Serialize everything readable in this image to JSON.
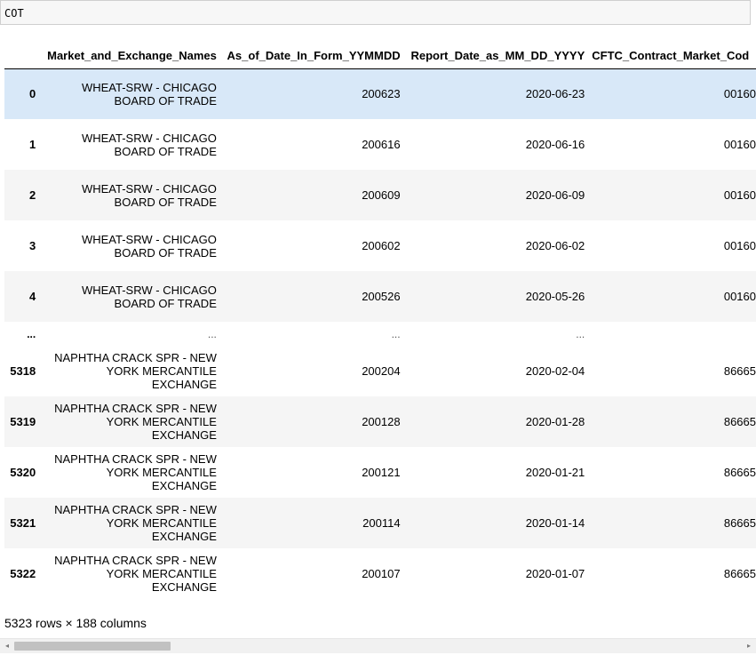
{
  "cell_input": "COT",
  "table": {
    "columns": [
      "Market_and_Exchange_Names",
      "As_of_Date_In_Form_YYMMDD",
      "Report_Date_as_MM_DD_YYYY",
      "CFTC_Contract_Market_Cod"
    ],
    "rows": [
      {
        "index": "0",
        "name_lines": [
          "WHEAT-SRW - CHICAGO",
          "BOARD OF TRADE"
        ],
        "yymmdd": "200623",
        "date": "2020-06-23",
        "code": "00160"
      },
      {
        "index": "1",
        "name_lines": [
          "WHEAT-SRW - CHICAGO",
          "BOARD OF TRADE"
        ],
        "yymmdd": "200616",
        "date": "2020-06-16",
        "code": "00160"
      },
      {
        "index": "2",
        "name_lines": [
          "WHEAT-SRW - CHICAGO",
          "BOARD OF TRADE"
        ],
        "yymmdd": "200609",
        "date": "2020-06-09",
        "code": "00160"
      },
      {
        "index": "3",
        "name_lines": [
          "WHEAT-SRW - CHICAGO",
          "BOARD OF TRADE"
        ],
        "yymmdd": "200602",
        "date": "2020-06-02",
        "code": "00160"
      },
      {
        "index": "4",
        "name_lines": [
          "WHEAT-SRW - CHICAGO",
          "BOARD OF TRADE"
        ],
        "yymmdd": "200526",
        "date": "2020-05-26",
        "code": "00160"
      }
    ],
    "ellipsis_row": {
      "index": "...",
      "cell": "..."
    },
    "rows_tail": [
      {
        "index": "5318",
        "name_lines": [
          "NAPHTHA CRACK SPR - NEW",
          "YORK MERCANTILE",
          "EXCHANGE"
        ],
        "yymmdd": "200204",
        "date": "2020-02-04",
        "code": "86665"
      },
      {
        "index": "5319",
        "name_lines": [
          "NAPHTHA CRACK SPR - NEW",
          "YORK MERCANTILE",
          "EXCHANGE"
        ],
        "yymmdd": "200128",
        "date": "2020-01-28",
        "code": "86665"
      },
      {
        "index": "5320",
        "name_lines": [
          "NAPHTHA CRACK SPR - NEW",
          "YORK MERCANTILE",
          "EXCHANGE"
        ],
        "yymmdd": "200121",
        "date": "2020-01-21",
        "code": "86665"
      },
      {
        "index": "5321",
        "name_lines": [
          "NAPHTHA CRACK SPR - NEW",
          "YORK MERCANTILE",
          "EXCHANGE"
        ],
        "yymmdd": "200114",
        "date": "2020-01-14",
        "code": "86665"
      },
      {
        "index": "5322",
        "name_lines": [
          "NAPHTHA CRACK SPR - NEW",
          "YORK MERCANTILE",
          "EXCHANGE"
        ],
        "yymmdd": "200107",
        "date": "2020-01-07",
        "code": "86665"
      }
    ]
  },
  "shape_text": "5323 rows × 188 columns",
  "scrollbar": {
    "left_arrow_icon": "◂",
    "right_arrow_icon": "▸"
  }
}
